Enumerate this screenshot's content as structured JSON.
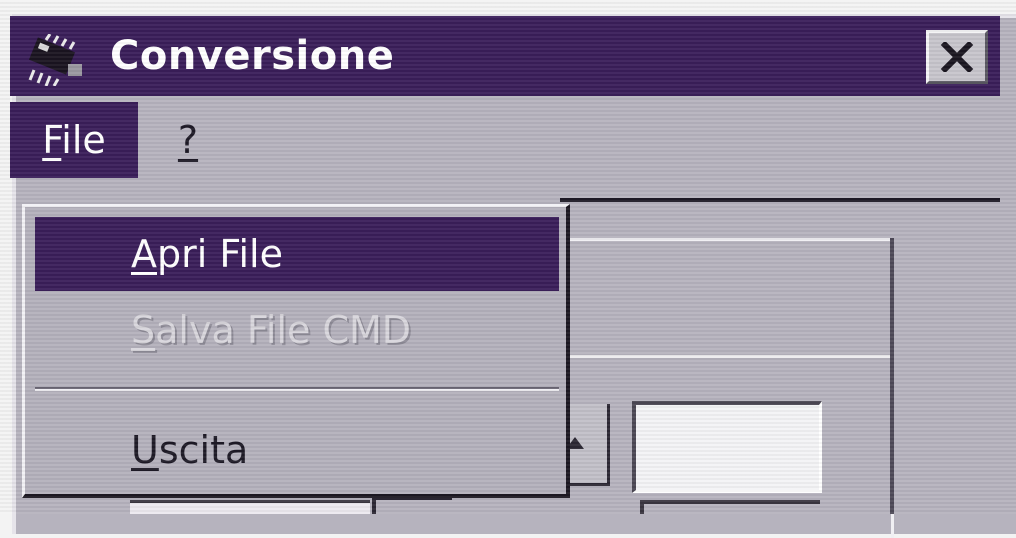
{
  "window": {
    "title": "Conversione",
    "icon": "chip-icon",
    "close_icon": "close-icon"
  },
  "menubar": {
    "items": [
      {
        "pre": "",
        "accel": "F",
        "post": "ile"
      },
      {
        "label": "?"
      }
    ]
  },
  "file_menu": {
    "items": [
      {
        "pre": "",
        "accel": "A",
        "post": "pri File",
        "state": "highlighted"
      },
      {
        "pre": "",
        "accel": "S",
        "post": "alva File CMD",
        "state": "disabled"
      },
      {
        "pre": "",
        "accel": "U",
        "post": "scita",
        "state": "enabled"
      }
    ]
  },
  "colors": {
    "title_bar": "#3a1e5a",
    "highlight": "#3a1e5a",
    "window_face": "#b6b3be",
    "disabled_text": "#d8d6dc"
  }
}
